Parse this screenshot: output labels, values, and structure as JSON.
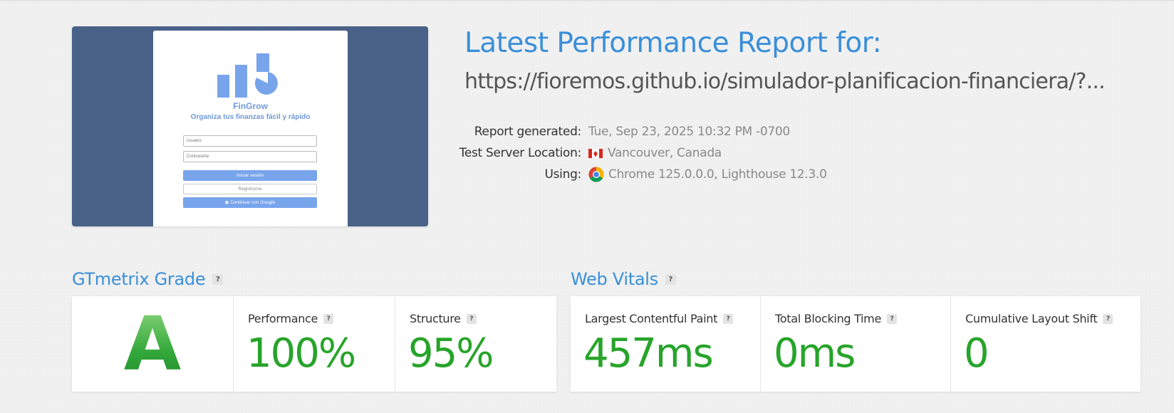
{
  "screenshot": {
    "brand": "FinGrow",
    "tagline": "Organiza tus finanzas fácil y rápido",
    "username_placeholder": "Usuario",
    "password_placeholder": "Contraseña",
    "login_button": "Iniciar sesión",
    "register_button": "Registrarse",
    "google_button": "Continuar con Google",
    "page_bg_color": "#4a6288",
    "accent_color": "#78a4ec"
  },
  "report": {
    "title": "Latest Performance Report for:",
    "url": "https://fioremos.github.io/simulador-planificacion-financiera/?...",
    "meta": [
      {
        "label": "Report generated:",
        "value": "Tue, Sep 23, 2025 10:32 PM -0700",
        "icon": ""
      },
      {
        "label": "Test Server Location:",
        "value": "Vancouver, Canada",
        "icon": "canada-flag-icon"
      },
      {
        "label": "Using:",
        "value": "Chrome 125.0.0.0, Lighthouse 12.3.0",
        "icon": "chrome-icon"
      }
    ]
  },
  "grade_section": {
    "heading": "GTmetrix Grade",
    "help": "?",
    "grade": "A",
    "performance_label": "Performance",
    "performance_value": "100%",
    "structure_label": "Structure",
    "structure_value": "95%"
  },
  "vitals_section": {
    "heading": "Web Vitals",
    "help": "?",
    "lcp_label": "Largest Contentful Paint",
    "lcp_value": "457ms",
    "tbt_label": "Total Blocking Time",
    "tbt_value": "0ms",
    "cls_label": "Cumulative Layout Shift",
    "cls_value": "0"
  },
  "colors": {
    "title_blue": "#3a8fd9",
    "good_green": "#27a42a"
  }
}
